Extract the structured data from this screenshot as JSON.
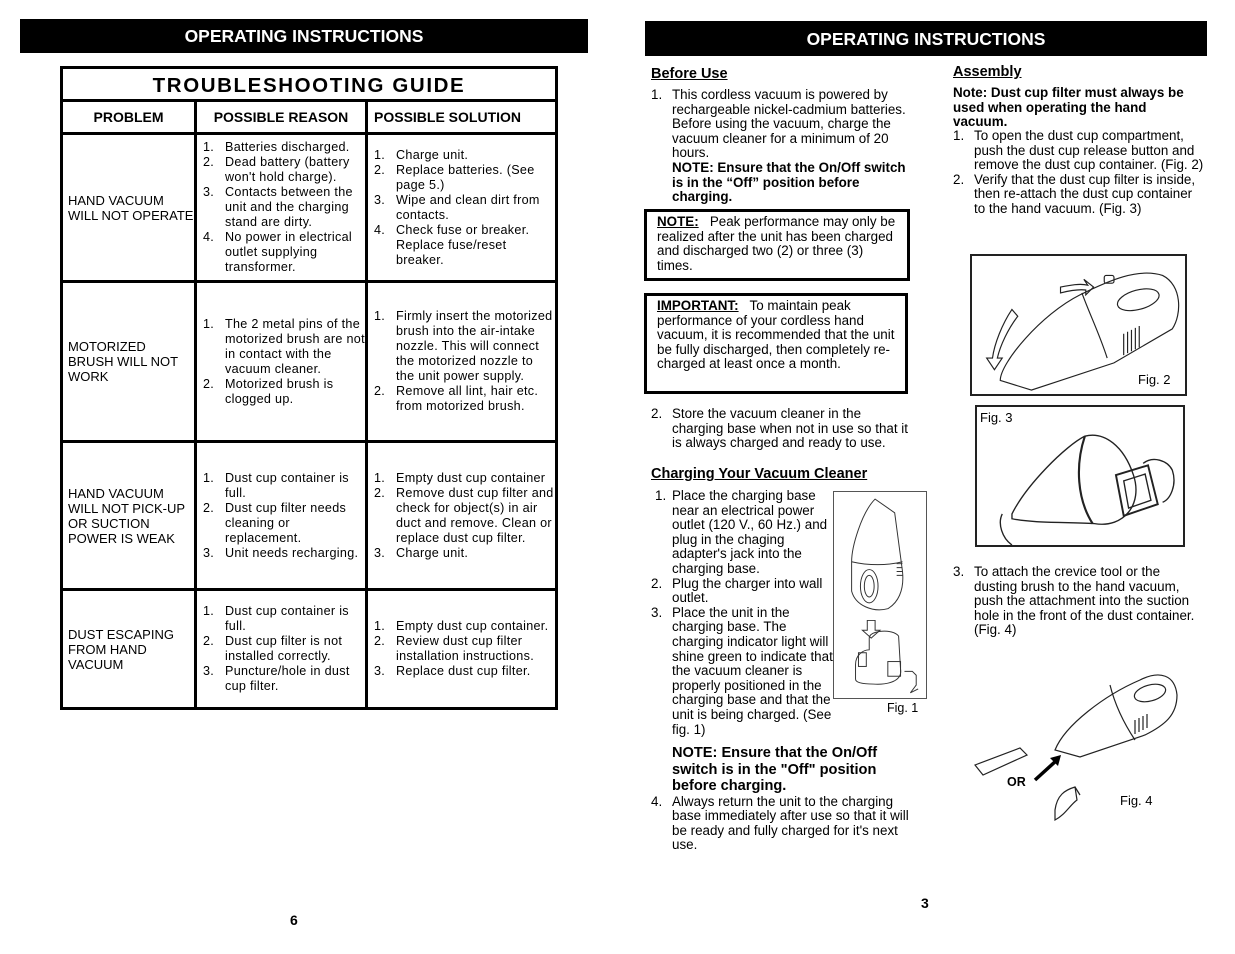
{
  "left_page": {
    "banner": "OPERATING INSTRUCTIONS",
    "table": {
      "title": "TROUBLESHOOTING GUIDE",
      "headers": [
        "PROBLEM",
        "POSSIBLE REASON",
        "POSSIBLE SOLUTION"
      ],
      "rows": [
        {
          "problem": "HAND VACUUM WILL NOT OPERATE",
          "reasons": [
            "Batteries discharged.",
            "Dead battery (battery won't hold charge).",
            "Contacts between the unit and the charging stand are dirty.",
            "No power in electrical outlet supplying transformer."
          ],
          "solutions": [
            "Charge unit.",
            "Replace batteries. (See page 5.)",
            "Wipe and clean dirt from contacts.",
            "Check fuse or breaker. Replace fuse/reset breaker."
          ]
        },
        {
          "problem": "MOTORIZED BRUSH WILL NOT WORK",
          "reasons": [
            "The 2 metal pins of the motorized brush are not in contact with the vacuum cleaner.",
            "Motorized brush is clogged up."
          ],
          "solutions": [
            "Firmly insert the motorized brush into the air-intake nozzle. This will connect the motorized nozzle to the unit power supply.",
            "Remove all lint, hair etc. from motorized brush."
          ]
        },
        {
          "problem": "HAND VACUUM WILL NOT PICK-UP OR SUCTION POWER IS WEAK",
          "reasons": [
            "Dust cup container is full.",
            "Dust cup filter needs cleaning or replacement.",
            "Unit needs recharging."
          ],
          "solutions": [
            "Empty dust cup container",
            "Remove dust cup filter and check for object(s) in air duct and remove. Clean or replace dust cup filter.",
            "Charge unit."
          ]
        },
        {
          "problem": "DUST ESCAPING FROM HAND VACUUM",
          "reasons": [
            "Dust cup container is full.",
            "Dust cup filter is not installed correctly.",
            "Puncture/hole in dust cup filter."
          ],
          "solutions": [
            "Empty dust cup container.",
            "Review dust cup filter installation instructions.",
            "Replace dust cup filter."
          ]
        }
      ]
    },
    "page_number": "6"
  },
  "right_page": {
    "banner": "OPERATING INSTRUCTIONS",
    "before_use": {
      "heading": "Before Use",
      "item1_num": "1.",
      "item1_text": "This cordless vacuum is powered by rechargeable nickel-cadmium batteries. Before using the vacuum, charge the vacuum cleaner for a minimum of 20 hours.",
      "item1_note": "NOTE: Ensure that the On/Off switch is in the “Off” position before charging.",
      "note_box_label": "NOTE:",
      "note_box_text": "Peak performance may only be realized after the unit has been charged and discharged two (2) or three (3) times.",
      "important_box_label": "IMPORTANT:",
      "important_box_text": "To maintain peak performance of your cordless hand vacuum, it is recommended that the unit be fully discharged, then completely re-charged at least once a month.",
      "item2_num": "2.",
      "item2_text": "Store the vacuum cleaner in the charging base when not in use so that it is always charged and ready  to use."
    },
    "charging": {
      "heading": "Charging Your Vacuum Cleaner",
      "items": [
        {
          "num": "1.",
          "text": "Place the charging base near an electrical power outlet (120 V., 60 Hz.) and plug in the chaging adapter's jack into the charging base."
        },
        {
          "num": "2.",
          "text": "Plug the charger into wall outlet."
        },
        {
          "num": "3.",
          "text": "Place the unit in the charging base. The charging indicator light will shine green to indicate that the vacuum cleaner is properly positioned in the charging base and that the unit is being charged. (See fig. 1)"
        }
      ],
      "note": "NOTE: Ensure that the On/Off switch is in the \"Off\" position before charging.",
      "item4_num": "4.",
      "item4_text": "Always return the unit to the charging base immediately after use so that it will be ready and fully charged for it's next use.",
      "fig1_caption": "Fig. 1"
    },
    "assembly": {
      "heading": "Assembly",
      "note": "Note: Dust cup filter must always be used when operating the hand vacuum.",
      "items": [
        {
          "num": "1.",
          "text": "To open the dust cup compartment, push the dust cup release button and  remove the dust cup container. (Fig. 2)"
        },
        {
          "num": "2.",
          "text": "Verify that the dust cup filter is inside, then re-attach the dust cup container to the hand vacuum. (Fig. 3)"
        }
      ],
      "fig2_caption": "Fig. 2",
      "fig3_caption": "Fig. 3",
      "item3_num": "3.",
      "item3_text": "To attach the crevice tool or the dusting brush to the hand vacuum, push the attachment into the suction hole in the front of the dust container. (Fig. 4)",
      "fig4_or_label": "OR",
      "fig4_caption": "Fig. 4"
    },
    "page_number": "3"
  }
}
